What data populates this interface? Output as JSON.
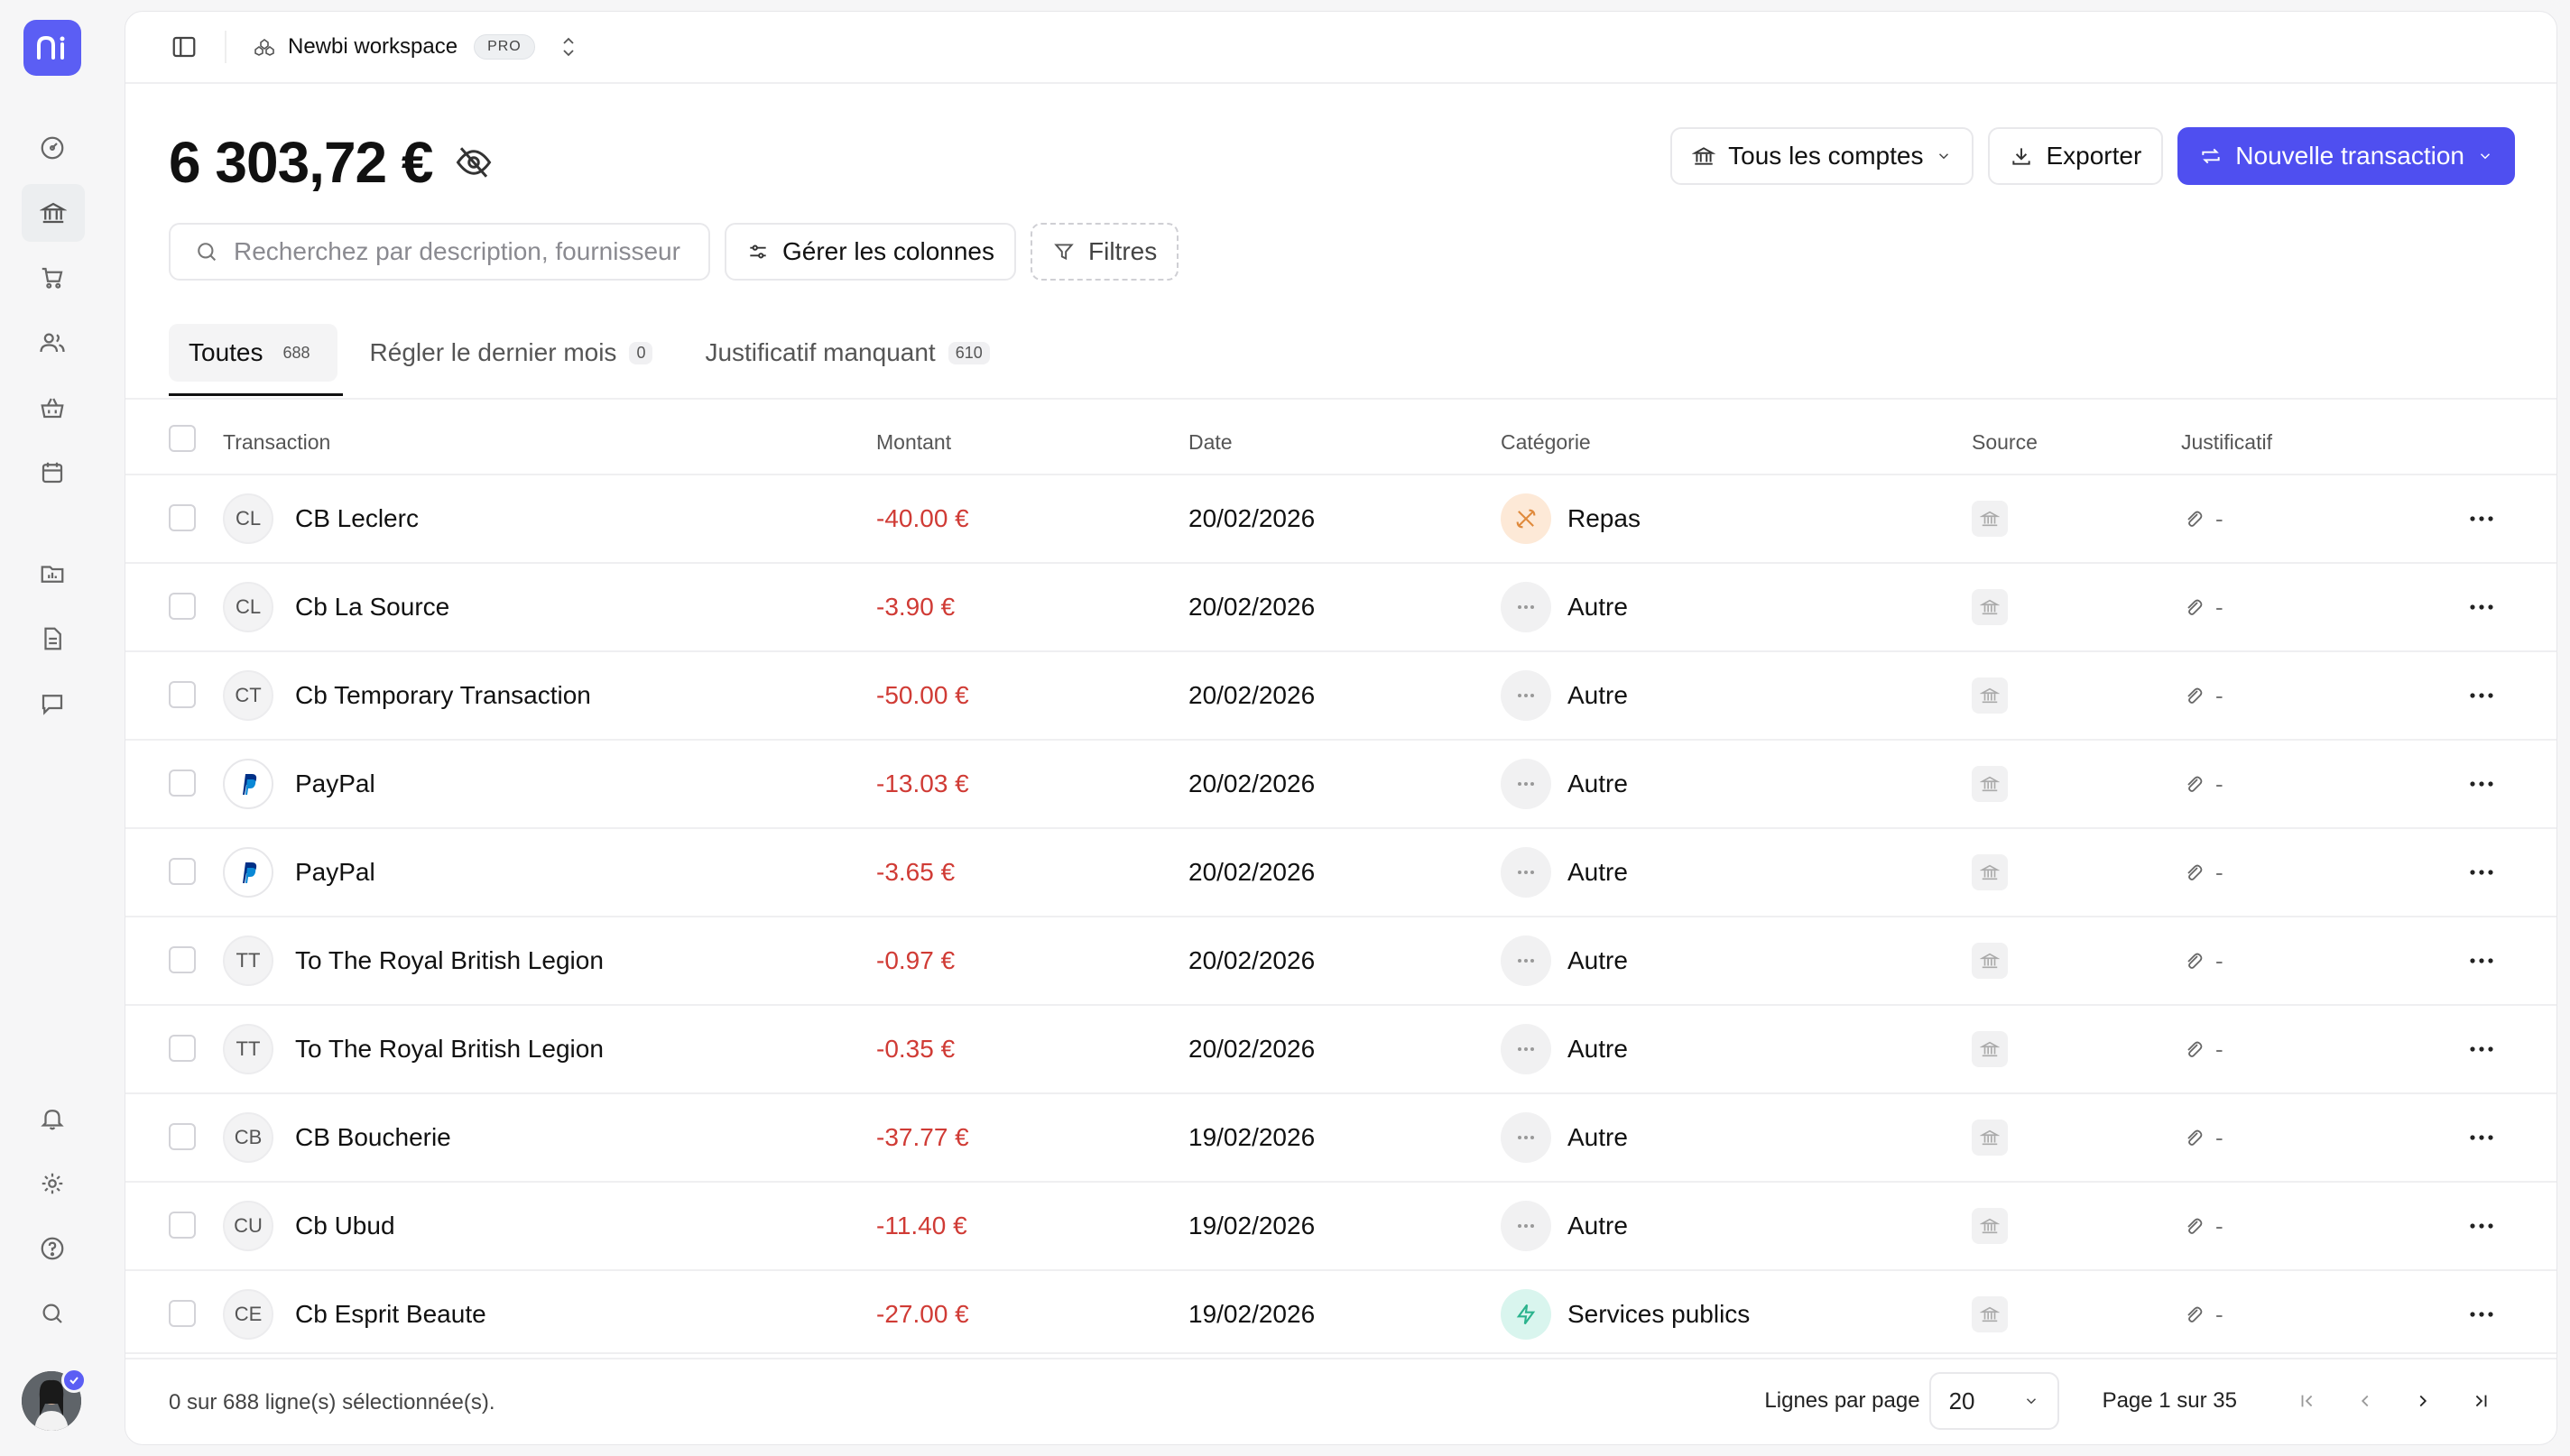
{
  "workspace": {
    "name": "Newbi workspace",
    "plan": "PRO"
  },
  "balance": "6 303,72 €",
  "actions": {
    "accounts": "Tous les comptes",
    "export": "Exporter",
    "new_transaction": "Nouvelle transaction"
  },
  "toolbar": {
    "search_placeholder": "Recherchez par description, fournisseur",
    "columns": "Gérer les colonnes",
    "filters": "Filtres"
  },
  "tabs": [
    {
      "label": "Toutes",
      "count": "688"
    },
    {
      "label": "Régler le dernier mois",
      "count": "0"
    },
    {
      "label": "Justificatif manquant",
      "count": "610"
    }
  ],
  "columns": [
    "Transaction",
    "Montant",
    "Date",
    "Catégorie",
    "Source",
    "Justificatif"
  ],
  "rows": [
    {
      "initials": "CL",
      "name": "CB Leclerc",
      "amount": "-40.00 €",
      "date": "20/02/2026",
      "category": "Repas",
      "cat_icon": "food-icon",
      "receipt": "-"
    },
    {
      "initials": "CL",
      "name": "Cb La Source",
      "amount": "-3.90 €",
      "date": "20/02/2026",
      "category": "Autre",
      "cat_icon": "more-icon",
      "receipt": "-"
    },
    {
      "initials": "CT",
      "name": "Cb Temporary Transaction",
      "amount": "-50.00 €",
      "date": "20/02/2026",
      "category": "Autre",
      "cat_icon": "more-icon",
      "receipt": "-"
    },
    {
      "initials": "",
      "logo": "paypal-logo",
      "name": "PayPal",
      "amount": "-13.03 €",
      "date": "20/02/2026",
      "category": "Autre",
      "cat_icon": "more-icon",
      "receipt": "-"
    },
    {
      "initials": "",
      "logo": "paypal-logo",
      "name": "PayPal",
      "amount": "-3.65 €",
      "date": "20/02/2026",
      "category": "Autre",
      "cat_icon": "more-icon",
      "receipt": "-"
    },
    {
      "initials": "TT",
      "name": "To The Royal British Legion",
      "amount": "-0.97 €",
      "date": "20/02/2026",
      "category": "Autre",
      "cat_icon": "more-icon",
      "receipt": "-"
    },
    {
      "initials": "TT",
      "name": "To The Royal British Legion",
      "amount": "-0.35 €",
      "date": "20/02/2026",
      "category": "Autre",
      "cat_icon": "more-icon",
      "receipt": "-"
    },
    {
      "initials": "CB",
      "name": "CB Boucherie",
      "amount": "-37.77 €",
      "date": "19/02/2026",
      "category": "Autre",
      "cat_icon": "more-icon",
      "receipt": "-"
    },
    {
      "initials": "CU",
      "name": "Cb Ubud",
      "amount": "-11.40 €",
      "date": "19/02/2026",
      "category": "Autre",
      "cat_icon": "more-icon",
      "receipt": "-"
    },
    {
      "initials": "CE",
      "name": "Cb Esprit Beaute",
      "amount": "-27.00 €",
      "date": "19/02/2026",
      "category": "Services publics",
      "cat_icon": "bolt-icon",
      "receipt": "-"
    }
  ],
  "footer": {
    "selection": "0 sur 688 ligne(s) sélectionnée(s).",
    "rows_per_page_label": "Lignes par page",
    "rows_per_page": "20",
    "page_info": "Page 1 sur 35"
  },
  "colors": {
    "primary": "#4f4ff0",
    "negative_amount": "#d03b35",
    "food": "#fde9d7",
    "utilities": "#d9f5ee"
  }
}
